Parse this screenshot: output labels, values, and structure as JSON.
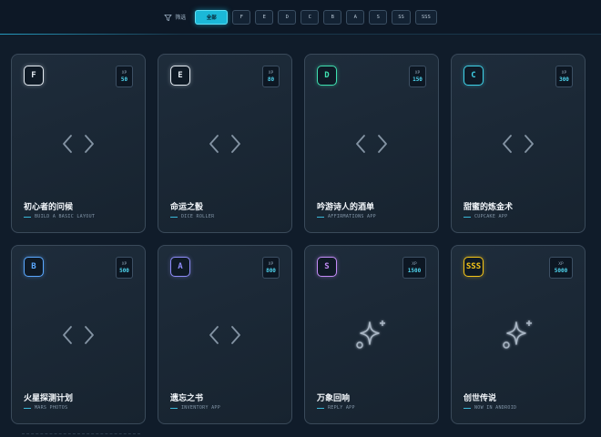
{
  "filter": {
    "label": "筛选",
    "icon": "filter-icon",
    "chips": [
      "全部",
      "F",
      "E",
      "D",
      "C",
      "B",
      "A",
      "S",
      "SS",
      "SSS"
    ],
    "active_index": 0
  },
  "cards": [
    {
      "rank": "F",
      "rank_color": "#e4ebf2",
      "xp_label": "XP",
      "xp": "50",
      "icon": "code-icon",
      "title": "初心者的问候",
      "subtitle": "BUILD A BASIC LAYOUT"
    },
    {
      "rank": "E",
      "rank_color": "#e4ebf2",
      "xp_label": "XP",
      "xp": "80",
      "icon": "code-icon",
      "title": "命运之骰",
      "subtitle": "DICE ROLLER"
    },
    {
      "rank": "D",
      "rank_color": "#3fe0b0",
      "xp_label": "XP",
      "xp": "150",
      "icon": "code-icon",
      "title": "吟游诗人的酒单",
      "subtitle": "AFFIRMATIONS APP"
    },
    {
      "rank": "C",
      "rank_color": "#3fd2e8",
      "xp_label": "XP",
      "xp": "300",
      "icon": "code-icon",
      "title": "甜蜜的炼金术",
      "subtitle": "CUPCAKE APP"
    },
    {
      "rank": "B",
      "rank_color": "#5aa8ff",
      "xp_label": "XP",
      "xp": "500",
      "icon": "code-icon",
      "title": "火星探测计划",
      "subtitle": "MARS PHOTOS"
    },
    {
      "rank": "A",
      "rank_color": "#8e8cf8",
      "xp_label": "XP",
      "xp": "800",
      "icon": "code-icon",
      "title": "遗忘之书",
      "subtitle": "INVENTORY APP"
    },
    {
      "rank": "S",
      "rank_color": "#c48cf8",
      "xp_label": "XP",
      "xp": "1500",
      "icon": "sparkle-icon",
      "title": "万象回响",
      "subtitle": "REPLY APP"
    },
    {
      "rank": "SSS",
      "rank_color": "#f5c518",
      "xp_label": "XP",
      "xp": "5000",
      "icon": "sparkle-icon",
      "title": "创世传说",
      "subtitle": "NOW IN ANDROID"
    }
  ]
}
